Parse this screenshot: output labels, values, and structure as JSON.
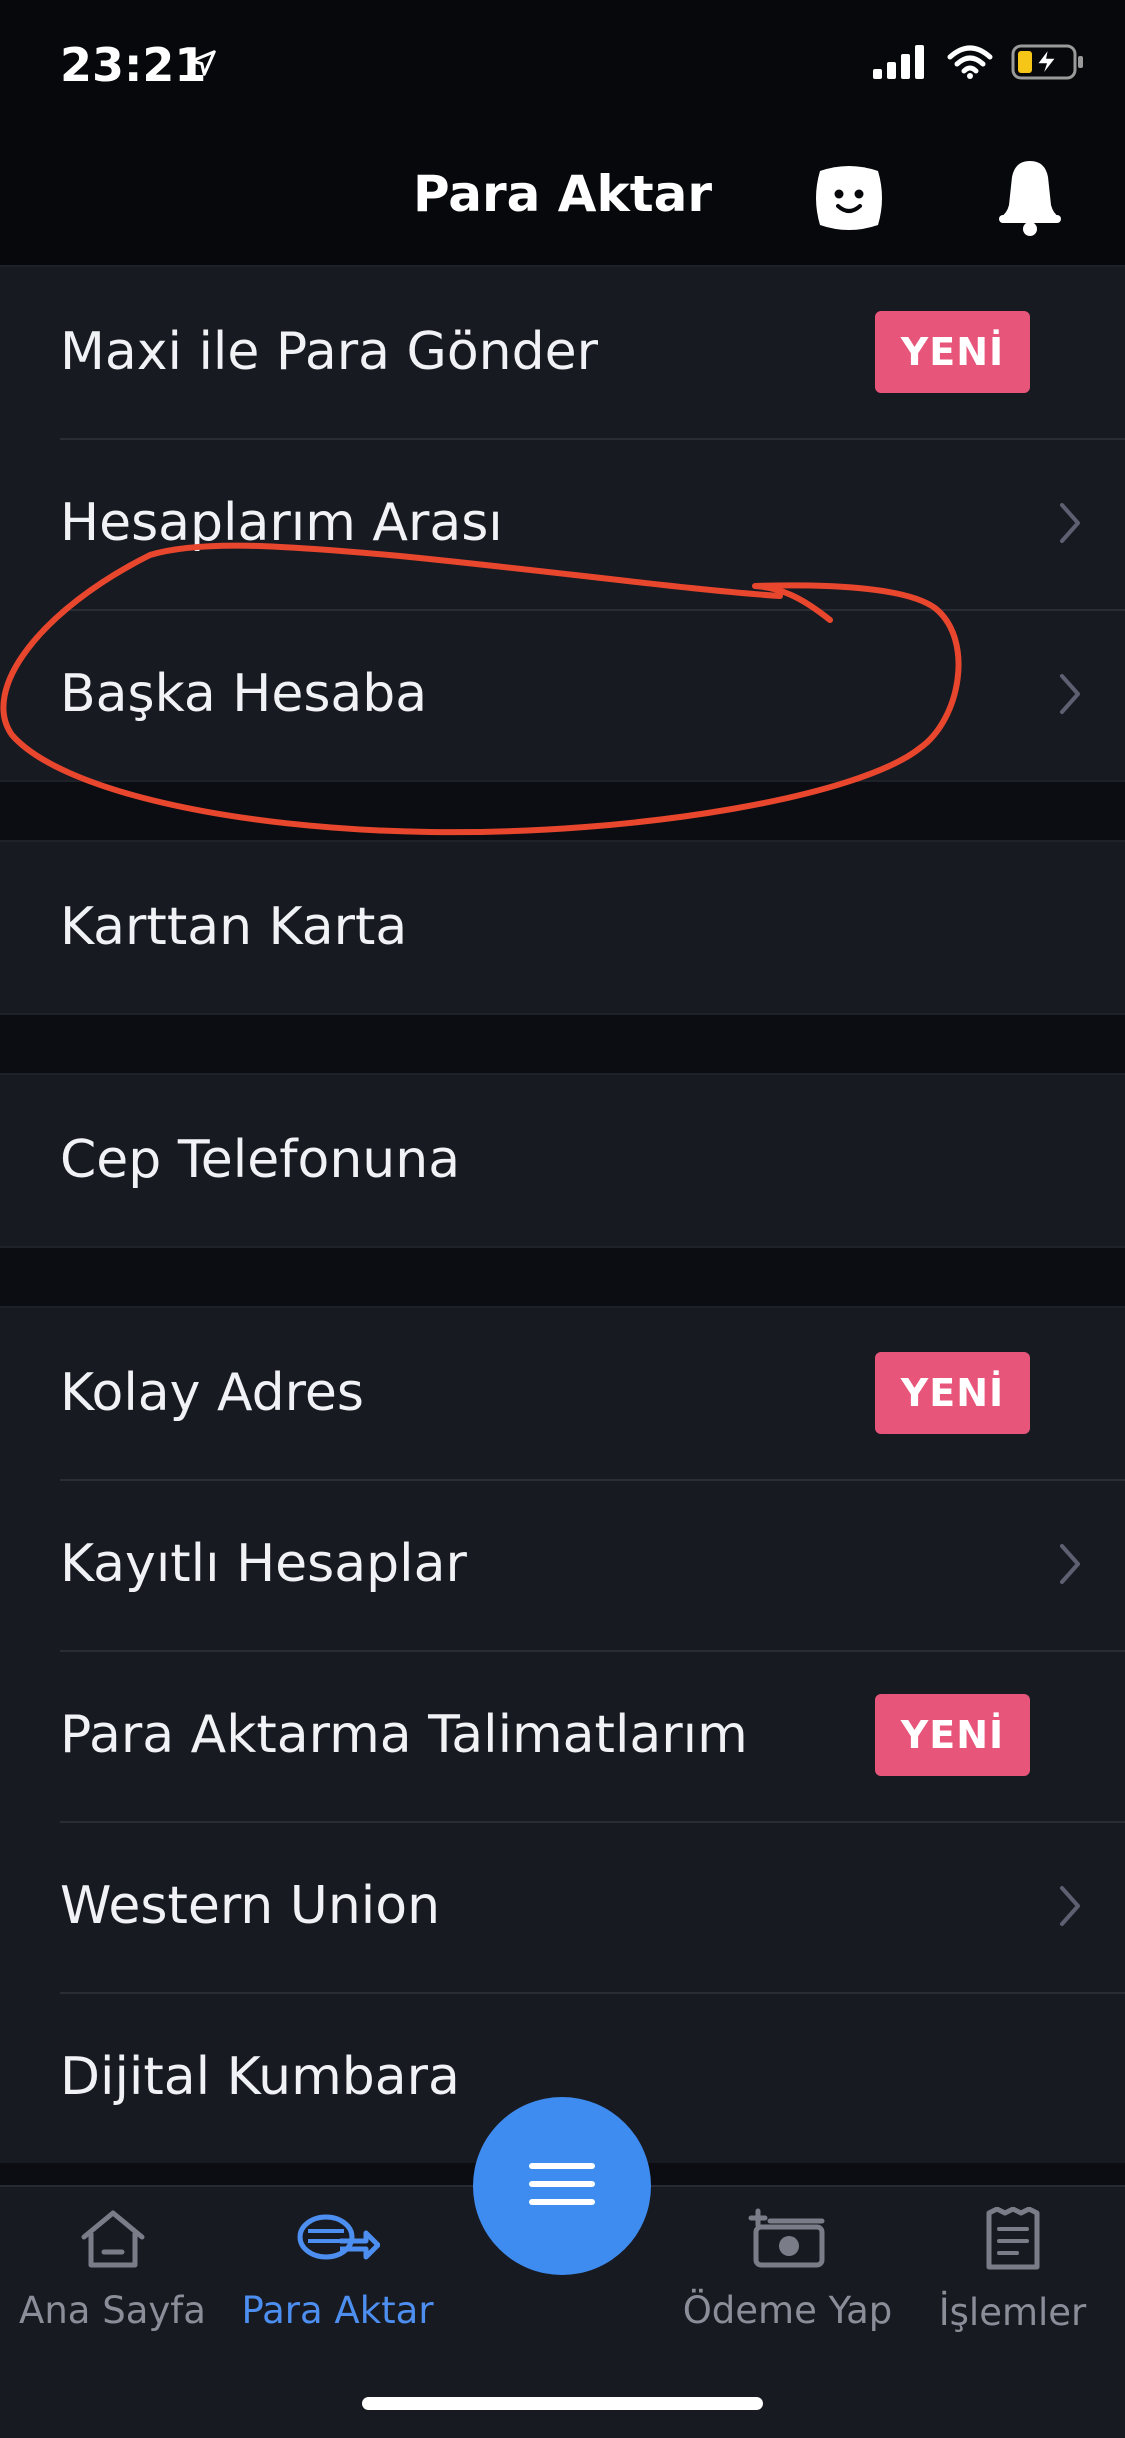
{
  "status_bar": {
    "time": "23:21"
  },
  "header": {
    "title": "Para Aktar"
  },
  "groups": [
    {
      "rows": [
        {
          "label": "Maxi ile Para Gönder",
          "badge": "YENİ"
        },
        {
          "label": "Hesaplarım Arası",
          "accessory": "chevron-right-icon"
        },
        {
          "label": "Başka Hesaba",
          "accessory": "chevron-right-icon"
        }
      ]
    },
    {
      "rows": [
        {
          "label": "Karttan Karta"
        }
      ]
    },
    {
      "rows": [
        {
          "label": "Cep Telefonuna"
        }
      ]
    },
    {
      "rows": [
        {
          "label": "Kolay Adres",
          "badge": "YENİ"
        },
        {
          "label": "Kayıtlı Hesaplar",
          "accessory": "chevron-right-icon"
        },
        {
          "label": "Para Aktarma Talimatlarım",
          "badge": "YENİ"
        },
        {
          "label": "Western Union",
          "accessory": "chevron-right-icon"
        },
        {
          "label": "Dijital Kumbara"
        }
      ]
    }
  ],
  "tabbar": {
    "tabs": [
      {
        "label": "Ana Sayfa",
        "icon": "home-icon"
      },
      {
        "label": "Para Aktar",
        "icon": "transfer-icon",
        "active": true
      },
      {
        "label": "Ödeme Yap",
        "icon": "payment-icon"
      },
      {
        "label": "İşlemler",
        "icon": "receipt-icon"
      }
    ],
    "menu_icon": "menu-icon"
  },
  "annotation": {
    "shape": "hand-drawn-ellipse",
    "color": "#e8472e"
  },
  "colors": {
    "badge": "#e8557a",
    "accent": "#4d8ff0",
    "fab": "#3f8cf0",
    "background": "#181a22"
  }
}
